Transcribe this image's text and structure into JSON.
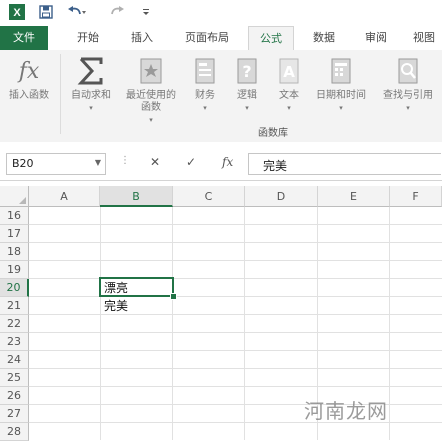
{
  "colors": {
    "accent": "#217346",
    "ribbon_bg": "#f3f3f3",
    "grid_line": "#e1e1e1"
  },
  "qat": {
    "icons": [
      "excel-logo-icon",
      "save-icon",
      "undo-icon",
      "redo-icon",
      "customize-qat-icon"
    ],
    "logo_letter": "X"
  },
  "tabs": [
    "文件",
    "开始",
    "插入",
    "页面布局",
    "公式",
    "数据",
    "审阅",
    "视图"
  ],
  "ribbon": {
    "buttons": [
      {
        "label": "插入函数",
        "icon": "fx-icon"
      },
      {
        "label": "自动求和",
        "icon": "sigma-icon",
        "has_arrow": true
      },
      {
        "label": "最近使用的\n函数",
        "icon": "recent-functions-icon",
        "has_arrow": true
      },
      {
        "label": "财务",
        "icon": "financial-icon",
        "has_arrow": true
      },
      {
        "label": "逻辑",
        "icon": "logical-icon",
        "has_arrow": true
      },
      {
        "label": "文本",
        "icon": "text-icon",
        "has_arrow": true
      },
      {
        "label": "日期和时间",
        "icon": "date-time-icon",
        "has_arrow": true
      },
      {
        "label": "查找与引用",
        "icon": "lookup-icon",
        "has_arrow": true
      }
    ],
    "group_label": "函数库"
  },
  "formula_bar": {
    "name_box": "B20",
    "cancel_symbol": "✕",
    "enter_symbol": "✓",
    "fx_symbol": "fx",
    "content": "完美"
  },
  "sheet": {
    "columns": [
      "A",
      "B",
      "C",
      "D",
      "E",
      "F"
    ],
    "rows": [
      "16",
      "17",
      "18",
      "19",
      "20",
      "21",
      "22",
      "23",
      "24",
      "25",
      "26",
      "27",
      "28"
    ],
    "active_cell": "B20",
    "cells": {
      "B20": "漂亮",
      "B21": "完美"
    }
  },
  "watermark": "河南龙网"
}
